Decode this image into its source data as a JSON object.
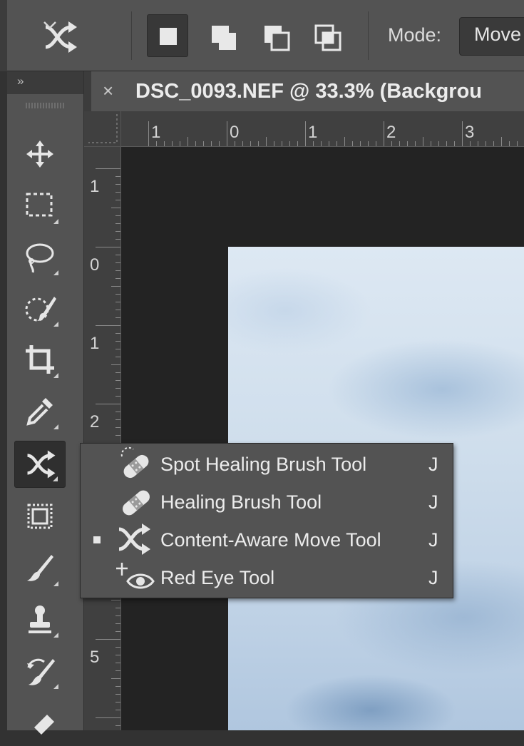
{
  "options_bar": {
    "tool_preset_icon": "content-aware-move-icon",
    "selection_modes": [
      {
        "name": "new-selection",
        "active": true
      },
      {
        "name": "add-to-selection",
        "active": false
      },
      {
        "name": "subtract-from-selection",
        "active": false
      },
      {
        "name": "intersect-with-selection",
        "active": false
      }
    ],
    "mode_label": "Mode:",
    "mode_value": "Move"
  },
  "toolbar": {
    "collapse_label": "»",
    "tools": [
      {
        "name": "move-tool",
        "icon": "move-icon",
        "active": false
      },
      {
        "name": "rectangular-marquee-tool",
        "icon": "marquee-icon",
        "active": false
      },
      {
        "name": "lasso-tool",
        "icon": "lasso-icon",
        "active": false
      },
      {
        "name": "quick-selection-tool",
        "icon": "quick-selection-icon",
        "active": false
      },
      {
        "name": "crop-tool",
        "icon": "crop-icon",
        "active": false
      },
      {
        "name": "eyedropper-tool",
        "icon": "eyedropper-icon",
        "active": false
      },
      {
        "name": "content-aware-move-tool",
        "icon": "content-aware-move-icon",
        "active": true
      },
      {
        "name": "frame-tool",
        "icon": "frame-icon",
        "active": false
      },
      {
        "name": "brush-tool",
        "icon": "brush-icon",
        "active": false
      },
      {
        "name": "clone-stamp-tool",
        "icon": "stamp-icon",
        "active": false
      },
      {
        "name": "history-brush-tool",
        "icon": "history-brush-icon",
        "active": false
      },
      {
        "name": "eraser-tool",
        "icon": "eraser-icon",
        "active": false
      }
    ]
  },
  "document": {
    "close_label": "×",
    "title": "DSC_0093.NEF @ 33.3% (Backgrou"
  },
  "rulers": {
    "horizontal_labels": [
      "1",
      "0",
      "1",
      "2",
      "3"
    ],
    "vertical_labels": [
      "1",
      "0",
      "1",
      "2",
      "5"
    ]
  },
  "flyout_menu": {
    "items": [
      {
        "label": "Spot Healing Brush Tool",
        "shortcut": "J",
        "icon": "spot-healing-brush-icon",
        "selected": false
      },
      {
        "label": "Healing Brush Tool",
        "shortcut": "J",
        "icon": "healing-brush-icon",
        "selected": false
      },
      {
        "label": "Content-Aware Move Tool",
        "shortcut": "J",
        "icon": "content-aware-move-icon",
        "selected": true
      },
      {
        "label": "Red Eye Tool",
        "shortcut": "J",
        "icon": "red-eye-icon",
        "selected": false
      }
    ]
  },
  "colors": {
    "panel": "#535353",
    "dark_panel": "#3c3c3c",
    "canvas_bg": "#232323",
    "text": "#ececec"
  }
}
